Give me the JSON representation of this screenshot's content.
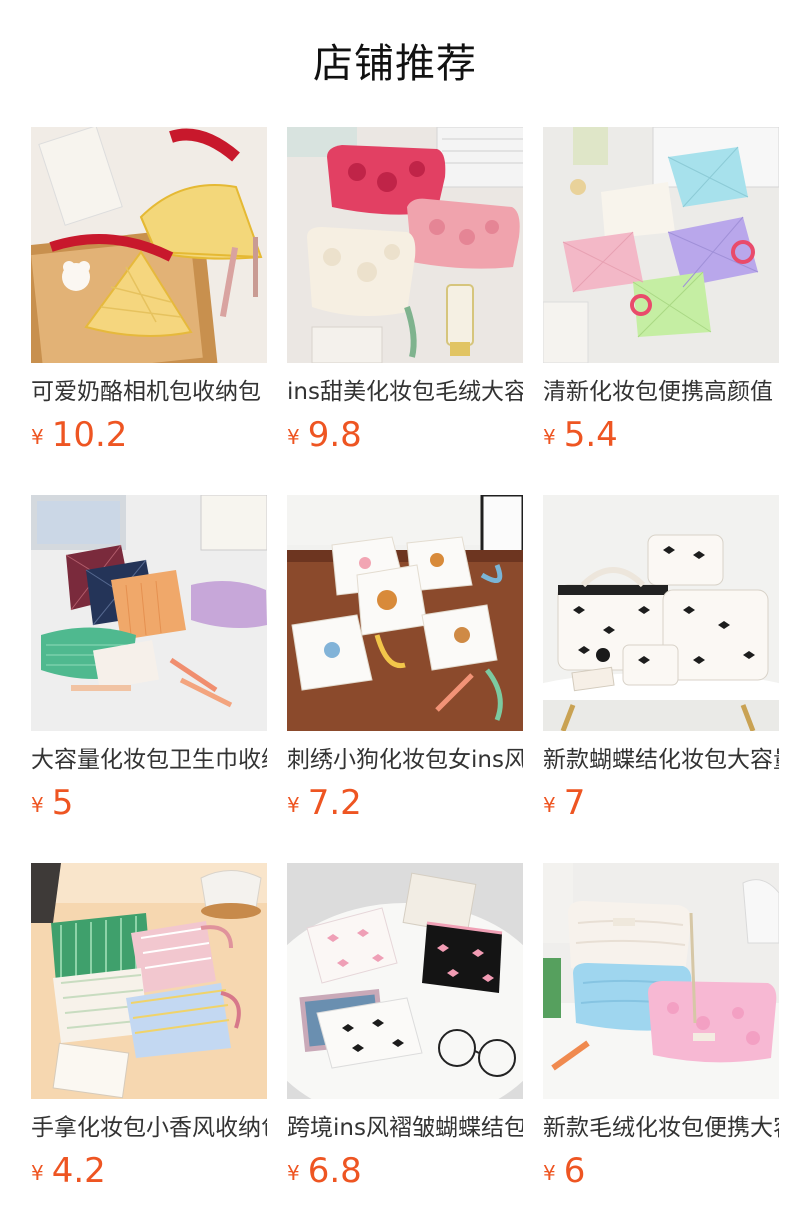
{
  "header": {
    "title": "店铺推荐"
  },
  "colors": {
    "price": "#ee5522",
    "title_text": "#333333",
    "heading": "#111111"
  },
  "products": [
    {
      "title": "可爱奶酪相机包收纳包",
      "currency": "¥",
      "price": "10.2",
      "image_icon": "cheese-camera-bag-photo"
    },
    {
      "title": "ins甜美化妆包毛绒大容量",
      "currency": "¥",
      "price": "9.8",
      "image_icon": "plush-cosmetic-bag-photo"
    },
    {
      "title": "清新化妆包便携高颜值",
      "currency": "¥",
      "price": "5.4",
      "image_icon": "pastel-quilted-pouch-photo"
    },
    {
      "title": "大容量化妆包卫生巾收纳",
      "currency": "¥",
      "price": "5",
      "image_icon": "plaid-pouch-photo"
    },
    {
      "title": "刺绣小狗化妆包女ins风",
      "currency": "¥",
      "price": "7.2",
      "image_icon": "embroidered-dog-pouch-photo"
    },
    {
      "title": "新款蝴蝶结化妆包大容量",
      "currency": "¥",
      "price": "7",
      "image_icon": "bow-print-bag-set-photo"
    },
    {
      "title": "手拿化妆包小香风收纳包",
      "currency": "¥",
      "price": "4.2",
      "image_icon": "tweed-clutch-pouch-photo"
    },
    {
      "title": "跨境ins风褶皱蝴蝶结包",
      "currency": "¥",
      "price": "6.8",
      "image_icon": "ruched-bow-pouch-photo"
    },
    {
      "title": "新款毛绒化妆包便携大容量",
      "currency": "¥",
      "price": "6",
      "image_icon": "fluffy-cosmetic-bag-photo"
    }
  ]
}
